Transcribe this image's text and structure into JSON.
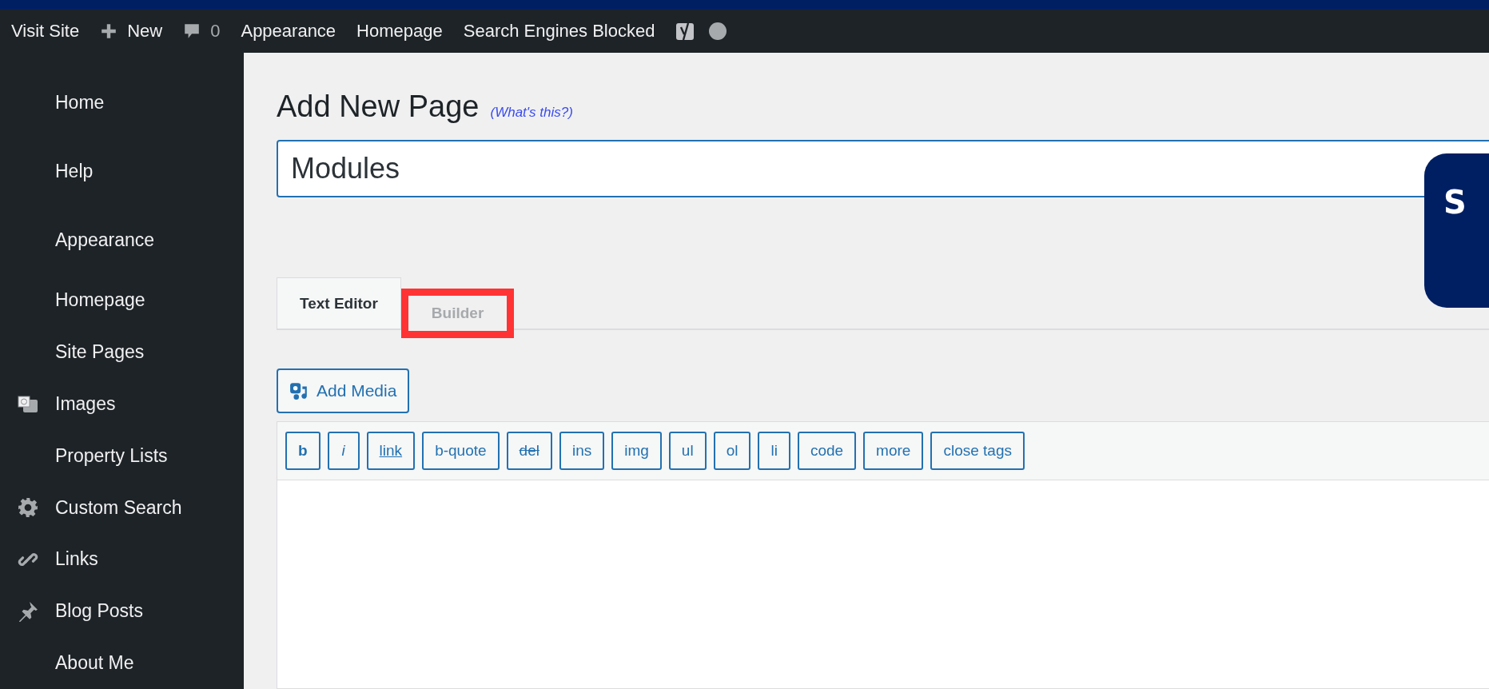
{
  "admin_bar": {
    "items": [
      {
        "kind": "link",
        "label": "Visit Site"
      },
      {
        "kind": "new",
        "label": "New"
      },
      {
        "kind": "comments",
        "label": "0"
      },
      {
        "kind": "link",
        "label": "Appearance"
      },
      {
        "kind": "link",
        "label": "Homepage"
      },
      {
        "kind": "link",
        "label": "Search Engines Blocked"
      },
      {
        "kind": "seo"
      },
      {
        "kind": "status"
      }
    ]
  },
  "sidebar": {
    "items": [
      {
        "label": "Home",
        "kind": "plain"
      },
      {
        "label": "Help",
        "kind": "plain"
      },
      {
        "label": "Appearance",
        "kind": "plain"
      },
      {
        "label": "Homepage",
        "kind": "plain"
      },
      {
        "label": "Site Pages",
        "kind": "plain"
      },
      {
        "label": "Images",
        "kind": "media"
      },
      {
        "label": "Property Lists",
        "kind": "plain"
      },
      {
        "label": "Custom Search",
        "kind": "gear"
      },
      {
        "label": "Links",
        "kind": "link"
      },
      {
        "label": "Blog Posts",
        "kind": "pin"
      },
      {
        "label": "About Me",
        "kind": "plain"
      }
    ]
  },
  "page": {
    "title": "Add New Page",
    "help_link": "(What's this?)",
    "title_field": {
      "value": "Modules"
    }
  },
  "tabs": [
    {
      "label": "Text Editor",
      "selected": true,
      "highlighted": false
    },
    {
      "label": "Builder",
      "selected": false,
      "highlighted": true
    }
  ],
  "add_media": {
    "label": "Add Media"
  },
  "toolbar": [
    {
      "label": "b",
      "kind": "bold"
    },
    {
      "label": "i",
      "kind": "italic"
    },
    {
      "label": "link",
      "kind": "underline"
    },
    {
      "label": "b-quote",
      "kind": "plain"
    },
    {
      "label": "del",
      "kind": "strike"
    },
    {
      "label": "ins",
      "kind": "plain"
    },
    {
      "label": "img",
      "kind": "plain"
    },
    {
      "label": "ul",
      "kind": "plain"
    },
    {
      "label": "ol",
      "kind": "plain"
    },
    {
      "label": "li",
      "kind": "plain"
    },
    {
      "label": "code",
      "kind": "plain"
    },
    {
      "label": "more",
      "kind": "plain"
    },
    {
      "label": "close tags",
      "kind": "plain"
    }
  ],
  "callout": {
    "text": "S"
  }
}
